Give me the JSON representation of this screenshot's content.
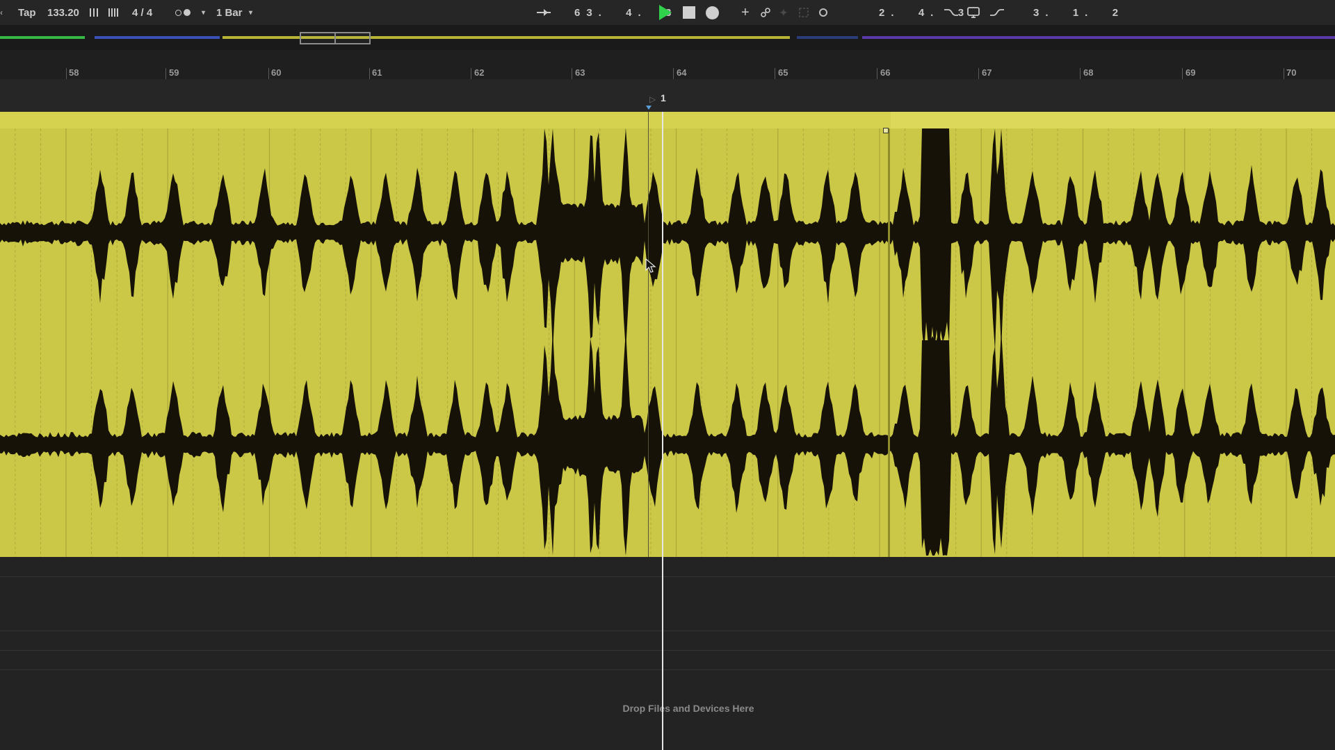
{
  "transport": {
    "tap_label": "Tap",
    "tempo": "133.20",
    "time_signature": "4 / 4",
    "quantize": "1 Bar",
    "arrangement_position": "63.  4.  3",
    "loop_start": "2.  4.  3",
    "loop_length": "3.  1.  2"
  },
  "icons": {
    "nudge": "nudge-icon",
    "metronome": "metronome-icon",
    "follow": "follow-icon",
    "play": "play-icon",
    "stop": "stop-icon",
    "record": "record-icon",
    "add": "add-icon",
    "link": "link-icon",
    "capture": "capture-icon",
    "curve": "curve-icon",
    "loop": "loop-icon",
    "punch": "punch-icon",
    "draw": "draw-icon"
  },
  "colors": {
    "clip": "#cbc847",
    "waveform": "#161208",
    "play": "#2fd24a",
    "background": "#1c1c1c"
  },
  "ruler": {
    "bars": [
      "58",
      "59",
      "60",
      "61",
      "62",
      "63",
      "64",
      "65",
      "66",
      "67",
      "68",
      "69",
      "70"
    ]
  },
  "locator": {
    "label": "1"
  },
  "lanes": {
    "drop_hint": "Drop Files and Devices Here"
  }
}
